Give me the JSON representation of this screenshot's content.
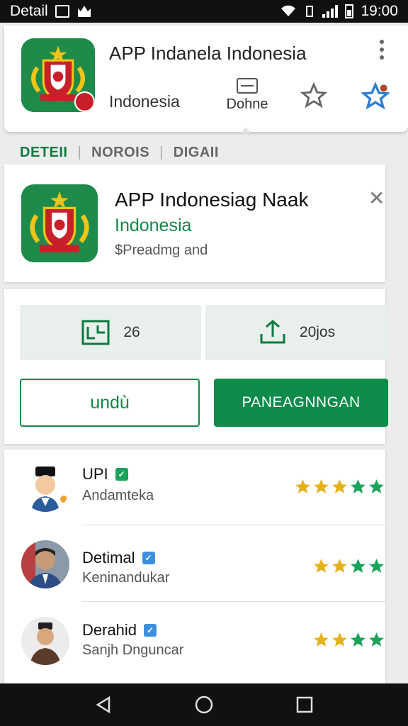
{
  "status_bar": {
    "title": "Detail",
    "time": "19:00"
  },
  "top_card": {
    "title": "APP Indanela Indonesia",
    "subtitle": "Indonesia",
    "donate_label": "Dohne"
  },
  "tabs": [
    {
      "label": "DETEII",
      "active": true
    },
    {
      "label": "NOROIS",
      "active": false
    },
    {
      "label": "DIGAII",
      "active": false
    }
  ],
  "app": {
    "title": "APP Indonesiag Naak",
    "developer": "Indonesia",
    "meta": "$Preadmg and"
  },
  "stats": [
    {
      "icon": "chart-icon",
      "value": "26"
    },
    {
      "icon": "share-icon",
      "value": "20jos"
    }
  ],
  "buttons": {
    "secondary": "undù",
    "primary": "PANEAGNNGAN"
  },
  "reviews": [
    {
      "name": "UPI",
      "location": "Andamteka",
      "rating": 5,
      "badge_color": "#1aa35a",
      "avatar": "avatar-cartoon-peci"
    },
    {
      "name": "Detimal",
      "location": "Keninandukar",
      "rating": 4,
      "badge_color": "#3d8fe0",
      "avatar": "avatar-man-photo"
    },
    {
      "name": "Derahid",
      "location": "Sanjh Dnguncar",
      "rating": 4,
      "badge_color": "#3d8fe0",
      "avatar": "avatar-illustration"
    }
  ],
  "colors": {
    "accent_green": "#0e8a4a",
    "star_gold": "#e6b21a",
    "star_green": "#1aa35a"
  }
}
